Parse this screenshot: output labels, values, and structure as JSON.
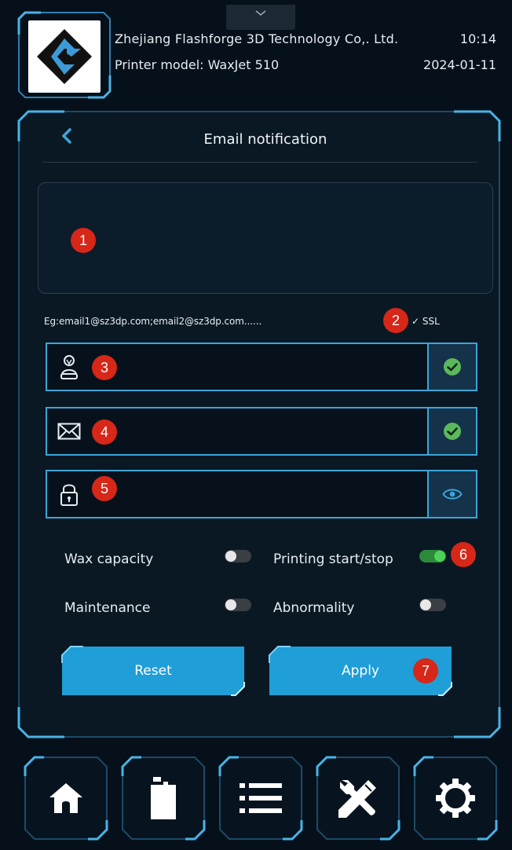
{
  "header": {
    "company": "Zhejiang Flashforge 3D Technology Co,. Ltd.",
    "model": "Printer model: WaxJet 510",
    "time": "10:14",
    "date": "2024-01-11"
  },
  "panel": {
    "title": "Email notification",
    "example_text": "Eg:email1@sz3dp.com;email2@sz3dp.com......",
    "ssl_label": "✓ SSL",
    "recipients_value": "",
    "user_field_value": "",
    "email_field_value": "",
    "password_field_value": ""
  },
  "options": [
    {
      "label": "Wax capacity",
      "on": false
    },
    {
      "label": "Printing start/stop",
      "on": true
    },
    {
      "label": "Maintenance",
      "on": false
    },
    {
      "label": "Abnormality",
      "on": false
    }
  ],
  "buttons": {
    "reset": "Reset",
    "apply": "Apply"
  },
  "markers": [
    "1",
    "2",
    "3",
    "4",
    "5",
    "6",
    "7"
  ],
  "nav": [
    "home-icon",
    "wax-bottle-icon",
    "list-icon",
    "tools-icon",
    "gear-icon"
  ],
  "colors": {
    "accent": "#3aa6d8",
    "button": "#1f9ed8",
    "toggle_on": "#4ed15a",
    "check_ok": "#5cb85c",
    "marker": "#d62718",
    "background": "#05101a"
  }
}
